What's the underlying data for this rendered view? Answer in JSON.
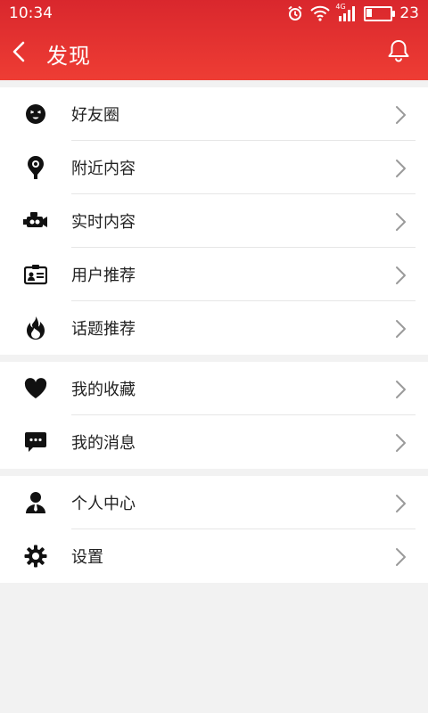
{
  "status_bar": {
    "time": "10:34",
    "battery_level": "23",
    "battery_fraction": 0.23,
    "network": "4G"
  },
  "header": {
    "title": "发现",
    "accent_color": "#e2302f"
  },
  "groups": [
    {
      "items": [
        {
          "label": "好友圈",
          "icon": "face-icon"
        },
        {
          "label": "附近内容",
          "icon": "location-pin-icon"
        },
        {
          "label": "实时内容",
          "icon": "video-camera-icon"
        },
        {
          "label": "用户推荐",
          "icon": "id-card-icon"
        },
        {
          "label": "话题推荐",
          "icon": "flame-icon"
        }
      ]
    },
    {
      "items": [
        {
          "label": "我的收藏",
          "icon": "heart-icon"
        },
        {
          "label": "我的消息",
          "icon": "chat-bubble-icon"
        }
      ]
    },
    {
      "items": [
        {
          "label": "个人中心",
          "icon": "person-icon"
        },
        {
          "label": "设置",
          "icon": "gear-icon"
        }
      ]
    }
  ]
}
